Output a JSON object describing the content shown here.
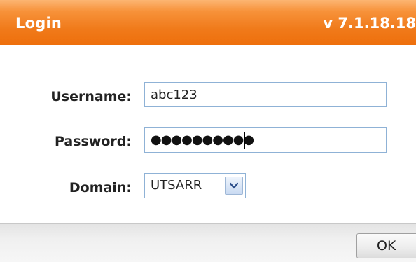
{
  "window": {
    "title": "Login",
    "version": "v 7.1.18.18"
  },
  "form": {
    "username_label": "Username:",
    "username_value": "abc123",
    "password_label": "Password:",
    "password_masked": "●●●●●●●●●●",
    "domain_label": "Domain:",
    "domain_value": "UTSARR"
  },
  "footer": {
    "ok_label": "OK"
  },
  "icons": {
    "domain_dropdown": "chevron-down-icon"
  },
  "colors": {
    "titlebar": "#f07a1a",
    "field_border": "#8fb2d6"
  }
}
